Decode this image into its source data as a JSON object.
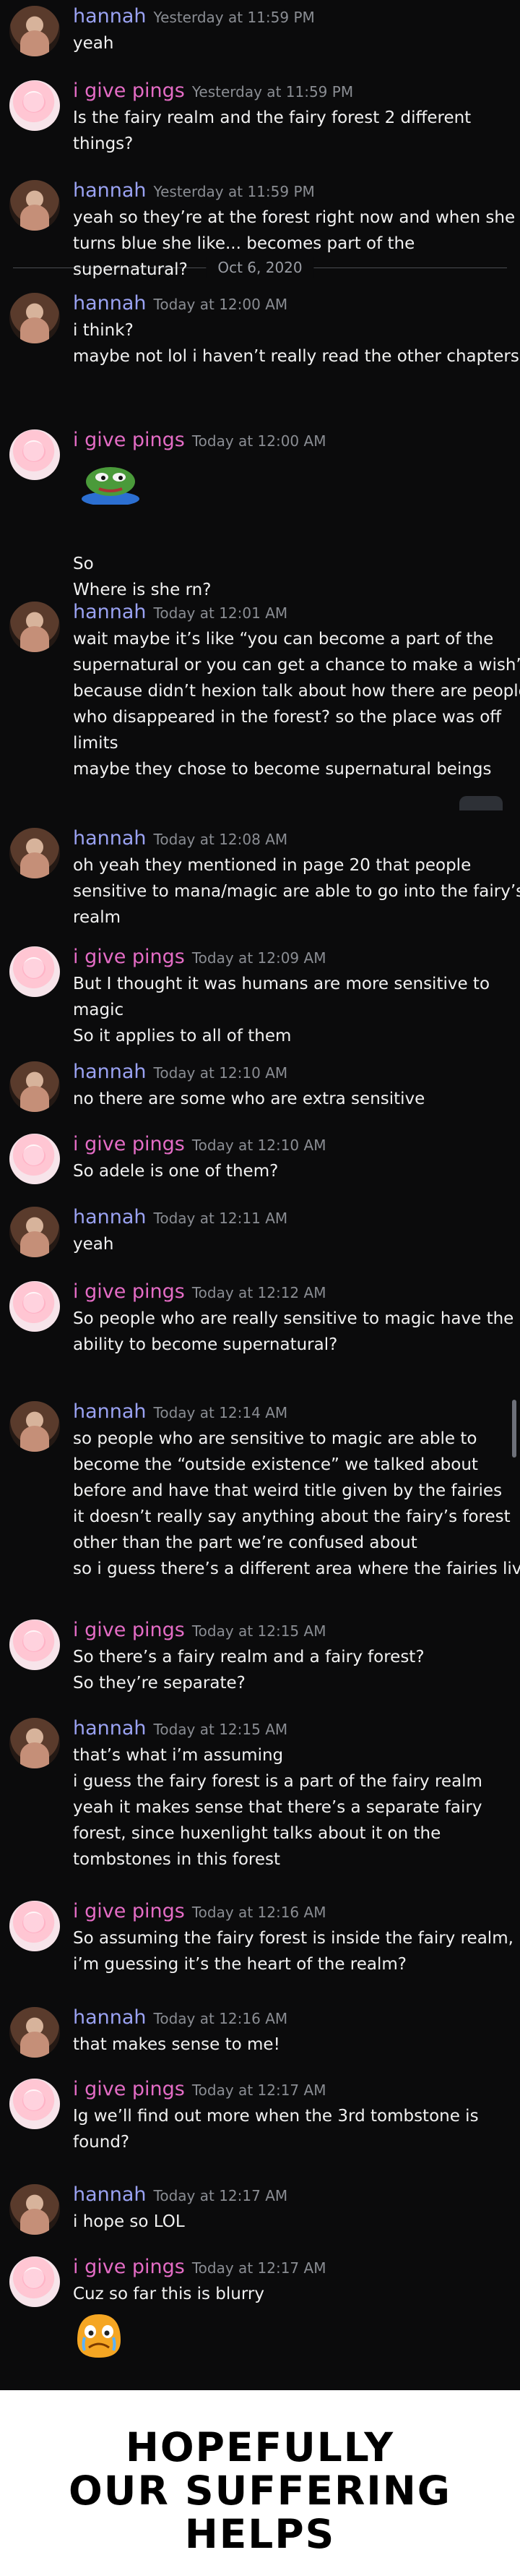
{
  "dividers": [
    {
      "label": "Oct 6, 2020"
    }
  ],
  "messages": [
    {
      "author": "hannah",
      "time": "Yesterday at 11:59 PM",
      "lines": [
        "yeah"
      ]
    },
    {
      "author": "i give pings",
      "time": "Yesterday at 11:59 PM",
      "lines": [
        "Is the fairy realm and the fairy forest 2 different",
        "things?"
      ]
    },
    {
      "author": "hannah",
      "time": "Yesterday at 11:59 PM",
      "lines": [
        "yeah so they’re at the forest right now and when she",
        "turns blue she like... becomes part of the",
        "supernatural?"
      ]
    },
    {
      "author": "hannah",
      "time": "Today at 12:00 AM",
      "lines": [
        "i think?",
        "maybe not lol i haven’t really read the other chapters"
      ]
    },
    {
      "author": "i give pings",
      "time": "Today at 12:00 AM",
      "lines": [
        "So",
        "Where is she rn?"
      ],
      "sticker": "peepo-frog-sticker"
    },
    {
      "author": "hannah",
      "time": "Today at 12:01 AM",
      "lines": [
        "wait maybe it’s like “you can become a part of the",
        "supernatural or you can get a chance to make a wish”",
        "because didn’t hexion talk about how there are people",
        "who disappeared in the forest? so the place was off",
        "limits",
        "maybe they chose to become supernatural beings"
      ]
    },
    {
      "author": "hannah",
      "time": "Today at 12:08 AM",
      "lines": [
        "oh yeah they mentioned in page 20 that people",
        "sensitive to mana/magic are able to go into the fairy’s",
        "realm"
      ]
    },
    {
      "author": "i give pings",
      "time": "Today at 12:09 AM",
      "lines": [
        "But I thought it was humans are more sensitive to",
        "magic",
        "So it applies to all of them"
      ]
    },
    {
      "author": "hannah",
      "time": "Today at 12:10 AM",
      "lines": [
        "no there are some who are extra sensitive"
      ]
    },
    {
      "author": "i give pings",
      "time": "Today at 12:10 AM",
      "lines": [
        "So adele is one of them?"
      ]
    },
    {
      "author": "hannah",
      "time": "Today at 12:11 AM",
      "lines": [
        "yeah"
      ]
    },
    {
      "author": "i give pings",
      "time": "Today at 12:12 AM",
      "lines": [
        "So people who are really sensitive to magic have the",
        "ability to become supernatural?"
      ]
    },
    {
      "author": "hannah",
      "time": "Today at 12:14 AM",
      "lines": [
        "so people who are sensitive to magic are able to",
        "become the “outside existence” we talked about",
        "before and have that weird title given by the fairies",
        "it doesn’t really say anything about the fairy’s forest",
        "other than the part we’re confused about",
        "so i guess there’s a different area where the fairies live"
      ]
    },
    {
      "author": "i give pings",
      "time": "Today at 12:15 AM",
      "lines": [
        "So there’s a fairy realm and a fairy forest?",
        "So they’re separate?"
      ]
    },
    {
      "author": "hannah",
      "time": "Today at 12:15 AM",
      "lines": [
        "that’s what i’m assuming",
        "i guess the fairy forest is a part of the fairy realm",
        "yeah it makes sense that there’s a separate fairy",
        "forest, since huxenlight talks about it on the",
        "tombstones in this forest"
      ]
    },
    {
      "author": "i give pings",
      "time": "Today at 12:16 AM",
      "lines": [
        "So assuming the fairy forest is inside the fairy realm,",
        "i’m guessing it’s the heart of the realm?"
      ]
    },
    {
      "author": "hannah",
      "time": "Today at 12:16 AM",
      "lines": [
        "that makes sense to me!"
      ]
    },
    {
      "author": "i give pings",
      "time": "Today at 12:17 AM",
      "lines": [
        "Ig we’ll find out more when the 3rd tombstone is",
        "found?"
      ]
    },
    {
      "author": "hannah",
      "time": "Today at 12:17 AM",
      "lines": [
        "i hope so LOL"
      ]
    },
    {
      "author": "i give pings",
      "time": "Today at 12:17 AM",
      "lines": [
        "Cuz so far this is blurry"
      ],
      "sticker": "crying-blob-sticker"
    }
  ],
  "caption": {
    "lines": [
      "HOPEFULLY",
      "OUR SUFFERING",
      "HELPS"
    ]
  }
}
